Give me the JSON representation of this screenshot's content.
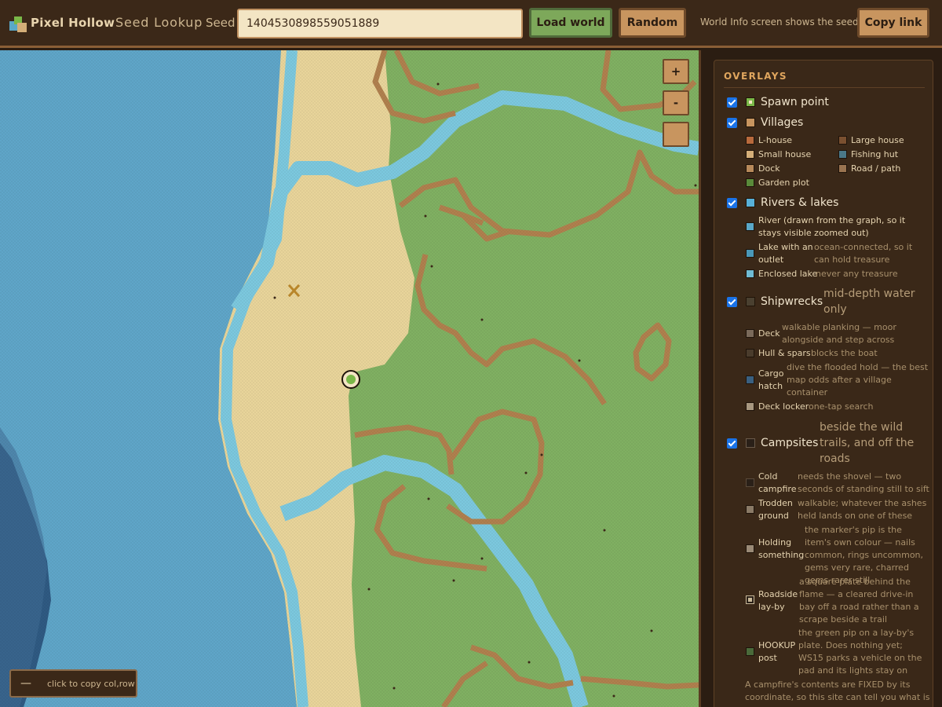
{
  "app": {
    "brand": "Pixel Hollow",
    "subtitle": "Seed Lookup"
  },
  "header": {
    "seed_label": "Seed",
    "seed_value": "1404530898559051889",
    "load_label": "Load world",
    "random_label": "Random",
    "hint": "World Info screen shows the seed",
    "copy_label": "Copy link"
  },
  "map": {
    "zoom_in": "+",
    "zoom_out": "-",
    "coord_dash": "—",
    "coord_hint": "click to copy col,row"
  },
  "overlays": {
    "title": "OVERLAYS",
    "groups": [
      {
        "label": "Spawn point",
        "checked": true,
        "color": "#7ab848",
        "desc": "",
        "items": []
      },
      {
        "label": "Villages",
        "checked": true,
        "color": "#c8955f",
        "desc": "",
        "items": [
          {
            "label": "L-house",
            "color": "#b86a3c",
            "desc": ""
          },
          {
            "label": "Large house",
            "color": "#7a5030",
            "desc": ""
          },
          {
            "label": "Small house",
            "color": "#d4ae78",
            "desc": ""
          },
          {
            "label": "Fishing hut",
            "color": "#4a7888",
            "desc": ""
          },
          {
            "label": "Dock",
            "color": "#b88a5a",
            "desc": ""
          },
          {
            "label": "Road / path",
            "color": "#9a7450",
            "desc": ""
          },
          {
            "label": "Garden plot",
            "color": "#5a8a3a",
            "desc": ""
          }
        ]
      },
      {
        "label": "Rivers & lakes",
        "checked": true,
        "color": "#58b0d8",
        "desc": "",
        "items": [
          {
            "label": "River (drawn from the graph, so it stays visible zoomed out)",
            "color": "#5aa8c8",
            "desc": ""
          },
          {
            "label": "Lake with an outlet",
            "color": "#4a98b8",
            "desc": "ocean-connected, so it can hold treasure"
          },
          {
            "label": "Enclosed lake",
            "color": "#70bcd4",
            "desc": "never any treasure"
          }
        ]
      },
      {
        "label": "Shipwrecks",
        "checked": true,
        "color": "#4a4030",
        "desc": "mid-depth water only",
        "items": [
          {
            "label": "Deck",
            "color": "#7a6a5a",
            "desc": "walkable planking — moor alongside and step across"
          },
          {
            "label": "Hull & spars",
            "color": "#4a3c2c",
            "desc": "blocks the boat"
          },
          {
            "label": "Cargo hatch",
            "color": "#3a6080",
            "desc": "dive the flooded hold — the best map odds after a village container"
          },
          {
            "label": "Deck locker",
            "color": "#a89880",
            "desc": "one-tap search"
          }
        ]
      },
      {
        "label": "Campsites",
        "checked": true,
        "color": "#2a2018",
        "desc": "beside the wild trails, and off the roads",
        "items": [
          {
            "label": "Cold campfire",
            "color": "#2a2018",
            "desc": "needs the shovel — two seconds of standing still to sift"
          },
          {
            "label": "Trodden ground",
            "color": "#8a7a66",
            "desc": "walkable; whatever the ashes held lands on one of these"
          },
          {
            "label": "Holding something",
            "color": "#9a8a76",
            "desc": "the marker's pip is the item's own colour — nails common, rings uncommon, gems very rare, charred gems rarer still"
          },
          {
            "label": "Roadside lay-by",
            "color": "#2a2018",
            "desc": "a square plate behind the flame — a cleared drive-in bay off a road rather than a scrape beside a trail"
          },
          {
            "label": "HOOKUP post",
            "color": "#4a6a3a",
            "desc": "the green pip on a lay-by's plate. Does nothing yet; WS15 parks a vehicle on the pad and its lights stay on"
          }
        ]
      }
    ],
    "footnote": "A campfire's contents are FIXED by its coordinate, so this site can tell you what is"
  },
  "colors": {
    "ocean_deep": "#2f5a82",
    "ocean": "#5fa5c8",
    "shallows": "#7cc8de",
    "sand": "#e8d49a",
    "grass": "#80b062",
    "path": "#b0804e",
    "accent": "#e0a65e"
  }
}
